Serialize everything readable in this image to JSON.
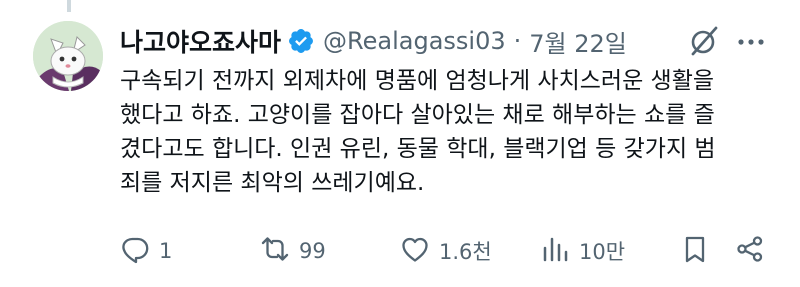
{
  "author": {
    "display_name": "나고야오죠사마",
    "handle": "@Realagassi03",
    "separator": "·",
    "date": "7월 22일",
    "verified_icon": "verified-badge-icon",
    "avatar": "cartoon-cat-avatar"
  },
  "header_icons": [
    "grok-icon",
    "more-icon"
  ],
  "tweet": {
    "lines": [
      "구속되기 전까지 외제차에 명품에 엄청나게 사치스러운 생활을",
      "했다고 하죠. 고양이를 잡아다 살아있는 채로 해부하는 쇼를 즐",
      "겼다고도 합니다. 인권 유린, 동물 학대, 블랙기업 등 갖가지 범",
      "죄를 저지른 최악의 쓰레기예요."
    ]
  },
  "actions": {
    "reply": {
      "icon": "reply-icon",
      "count": "1"
    },
    "retweet": {
      "icon": "retweet-icon",
      "count": "99"
    },
    "like": {
      "icon": "heart-icon",
      "count": "1.6천"
    },
    "views": {
      "icon": "views-icon",
      "count": "10만"
    },
    "bookmark": {
      "icon": "bookmark-icon"
    },
    "share": {
      "icon": "share-icon"
    }
  },
  "colors": {
    "text": "#0f1419",
    "secondary": "#536471",
    "verified": "#1d9bf0",
    "thread_line": "#cfd9de"
  }
}
